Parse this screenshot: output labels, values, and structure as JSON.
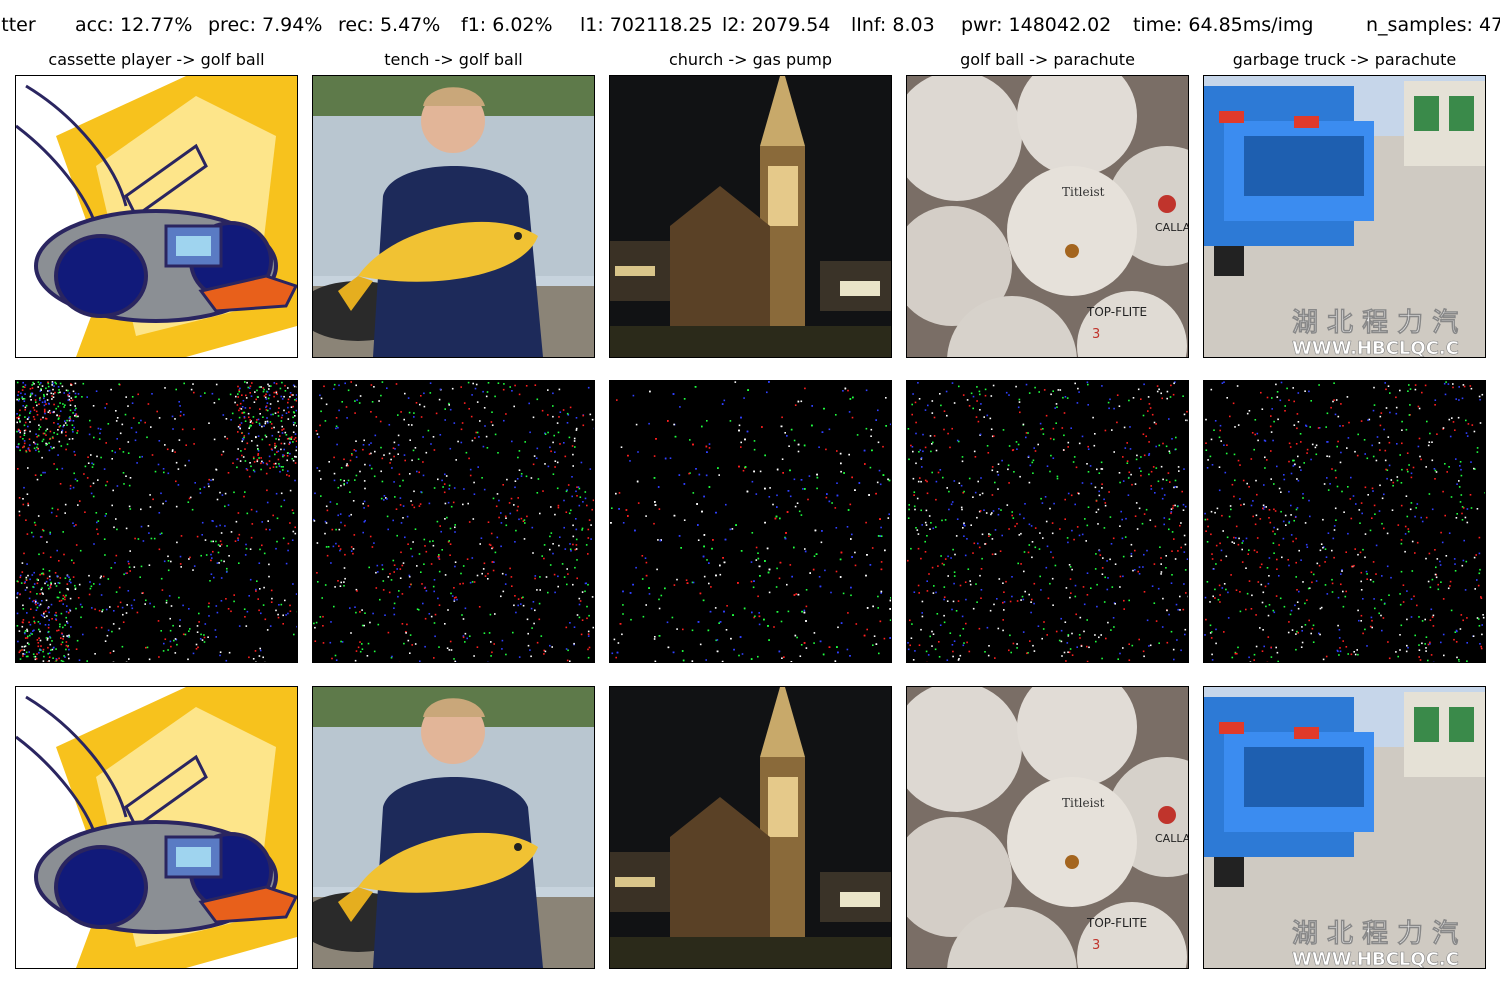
{
  "header": {
    "attack_name": "itter",
    "acc": "acc: 12.77%",
    "prec": "prec: 7.94%",
    "rec": "rec: 5.47%",
    "f1": "f1: 6.02%",
    "l1": "l1: 702118.25",
    "l2": "l2: 2079.54",
    "linf": "lInf: 8.03",
    "pwr": "pwr: 148042.02",
    "time": "time: 64.85ms/img",
    "n_samples": "n_samples: 47"
  },
  "columns": [
    {
      "title": "cassette player -> golf ball",
      "subject": "cassette-player-clipart"
    },
    {
      "title": "tench -> golf ball",
      "subject": "boy-holding-tench-fish"
    },
    {
      "title": "church -> gas pump",
      "subject": "church-at-night"
    },
    {
      "title": "golf ball -> parachute",
      "subject": "pile-of-golf-balls"
    },
    {
      "title": "garbage truck -> parachute",
      "subject": "blue-garbage-truck"
    }
  ],
  "rows": [
    "original",
    "perturbation",
    "adversarial"
  ],
  "images": {
    "ball_label_1": "Titleist",
    "ball_label_2": "CALLAWAY",
    "ball_label_3": "TOP-FLITE",
    "ball_number": "3",
    "truck_watermark_cn": "湖 北 程 力 汽",
    "truck_watermark_url": "WWW.HBCLQC.C"
  },
  "colors": {
    "noise_red": "#ff2020",
    "noise_green": "#20ff40",
    "noise_blue": "#3040ff",
    "noise_white": "#ffffff"
  }
}
